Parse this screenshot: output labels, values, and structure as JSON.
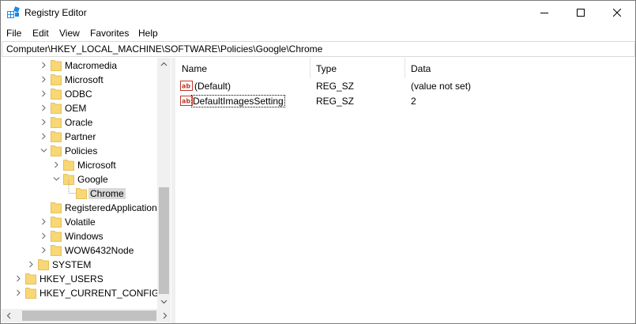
{
  "window": {
    "title": "Registry Editor",
    "controls": {
      "minimize": "minimize",
      "maximize": "maximize",
      "close": "close"
    }
  },
  "menu": [
    "File",
    "Edit",
    "View",
    "Favorites",
    "Help"
  ],
  "address": "Computer\\HKEY_LOCAL_MACHINE\\SOFTWARE\\Policies\\Google\\Chrome",
  "tree": {
    "items": [
      {
        "label": "Macromedia",
        "expander": "collapsed"
      },
      {
        "label": "Microsoft",
        "expander": "collapsed"
      },
      {
        "label": "ODBC",
        "expander": "collapsed"
      },
      {
        "label": "OEM",
        "expander": "collapsed"
      },
      {
        "label": "Oracle",
        "expander": "collapsed"
      },
      {
        "label": "Partner",
        "expander": "collapsed"
      },
      {
        "label": "Policies",
        "expander": "expanded"
      },
      {
        "label": "Microsoft",
        "expander": "collapsed"
      },
      {
        "label": "Google",
        "expander": "expanded"
      },
      {
        "label": "Chrome",
        "expander": "none",
        "selected": true
      },
      {
        "label": "RegisteredApplications",
        "expander": "none"
      },
      {
        "label": "Volatile",
        "expander": "collapsed"
      },
      {
        "label": "Windows",
        "expander": "collapsed"
      },
      {
        "label": "WOW6432Node",
        "expander": "collapsed"
      },
      {
        "label": "SYSTEM",
        "expander": "collapsed"
      },
      {
        "label": "HKEY_USERS",
        "expander": "collapsed"
      },
      {
        "label": "HKEY_CURRENT_CONFIG",
        "expander": "collapsed"
      }
    ]
  },
  "values": {
    "columns": [
      "Name",
      "Type",
      "Data"
    ],
    "rows": [
      {
        "name": "(Default)",
        "type": "REG_SZ",
        "data": "(value not set)",
        "icon": "string-value-icon"
      },
      {
        "name": "DefaultImagesSetting",
        "type": "REG_SZ",
        "data": "2",
        "icon": "string-value-icon",
        "focused": true
      }
    ]
  },
  "colors": {
    "folder": "#f8d775",
    "folder_dark": "#e0b440",
    "selection": "#d9d9d9",
    "ab_icon": "#c0392b"
  }
}
